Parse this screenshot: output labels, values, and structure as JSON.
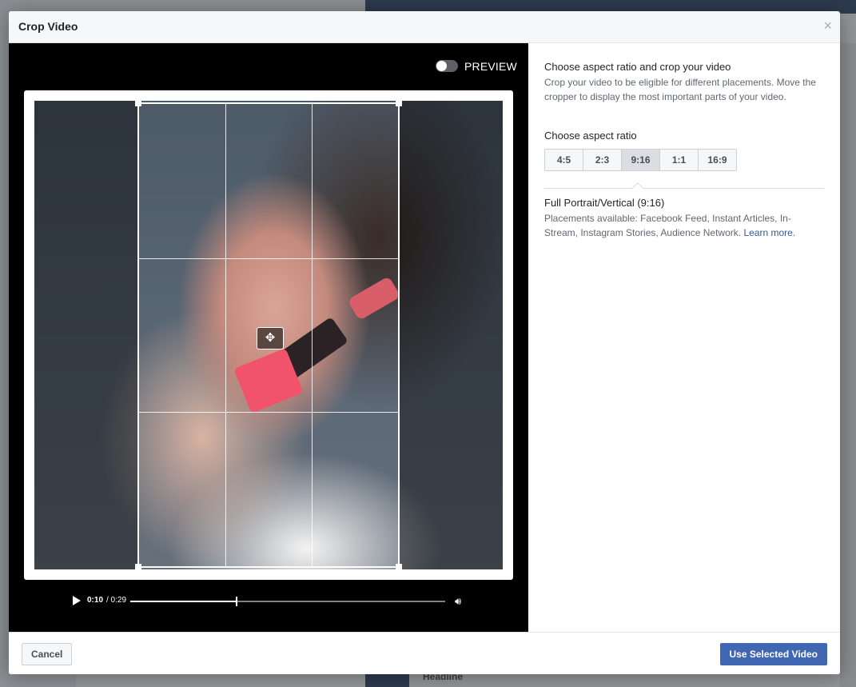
{
  "modal": {
    "title": "Crop Video",
    "close_glyph": "×"
  },
  "video": {
    "preview_label": "PREVIEW",
    "preview_on": false,
    "time_current": "0:10",
    "time_total": "/ 0:29",
    "progress": 0.335
  },
  "side": {
    "heading": "Choose aspect ratio and crop your video",
    "description": "Crop your video to be eligible for different placements. Move the cropper to display the most important parts of your video.",
    "ratio_label": "Choose aspect ratio",
    "ratios": [
      "4:5",
      "2:3",
      "9:16",
      "1:1",
      "16:9"
    ],
    "selected_ratio": "9:16",
    "format_title": "Full Portrait/Vertical (9:16)",
    "format_desc": "Placements available: Facebook Feed, Instant Articles, In-Stream, Instagram Stories, Audience Network.",
    "learn_more": "Learn more."
  },
  "footer": {
    "cancel_label": "Cancel",
    "use_label": "Use Selected Video"
  },
  "background": {
    "headline_label": "Headline"
  },
  "colors": {
    "primary": "#4267b2",
    "link": "#365899",
    "header_bg": "#f6f7f9"
  }
}
